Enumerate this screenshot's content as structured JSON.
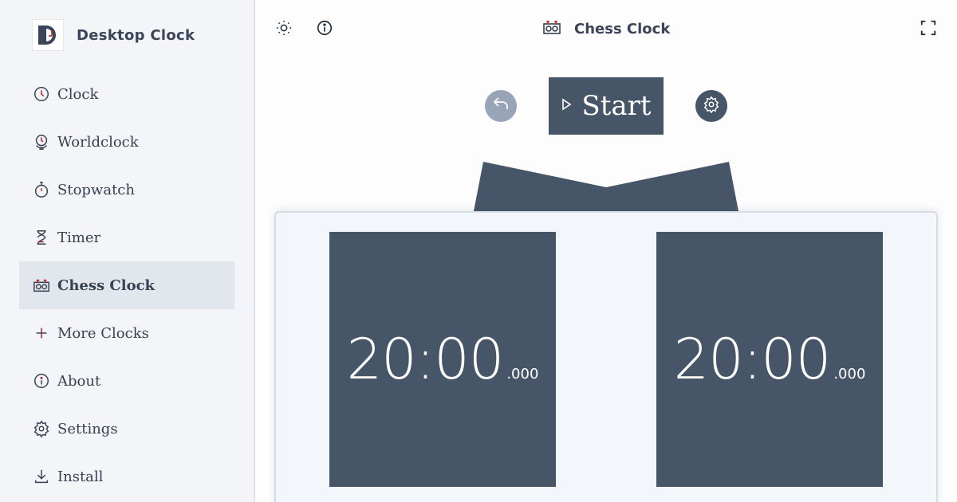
{
  "app": {
    "title": "Desktop Clock"
  },
  "sidebar": {
    "items": [
      {
        "label": "Clock",
        "icon": "clock-icon"
      },
      {
        "label": "Worldclock",
        "icon": "globe-clock-icon"
      },
      {
        "label": "Stopwatch",
        "icon": "stopwatch-icon"
      },
      {
        "label": "Timer",
        "icon": "hourglass-icon"
      },
      {
        "label": "Chess Clock",
        "icon": "chess-clock-icon",
        "active": true
      },
      {
        "label": "More Clocks",
        "icon": "plus-icon"
      },
      {
        "label": "About",
        "icon": "info-icon"
      },
      {
        "label": "Settings",
        "icon": "gear-icon"
      },
      {
        "label": "Install",
        "icon": "download-icon"
      }
    ]
  },
  "header": {
    "title": "Chess Clock",
    "icons": [
      "sun-icon",
      "info-icon",
      "chess-clock-icon",
      "fullscreen-icon"
    ]
  },
  "controls": {
    "start_label": "Start"
  },
  "players": [
    {
      "time": "20:00",
      "ms": ".000"
    },
    {
      "time": "20:00",
      "ms": ".000"
    }
  ],
  "colors": {
    "accent": "#475569",
    "sidebar_bg": "#f3f5f8",
    "active_bg": "#e2e6ed",
    "reset_bg": "#98a4b8",
    "brand_red": "#b91c1c"
  }
}
